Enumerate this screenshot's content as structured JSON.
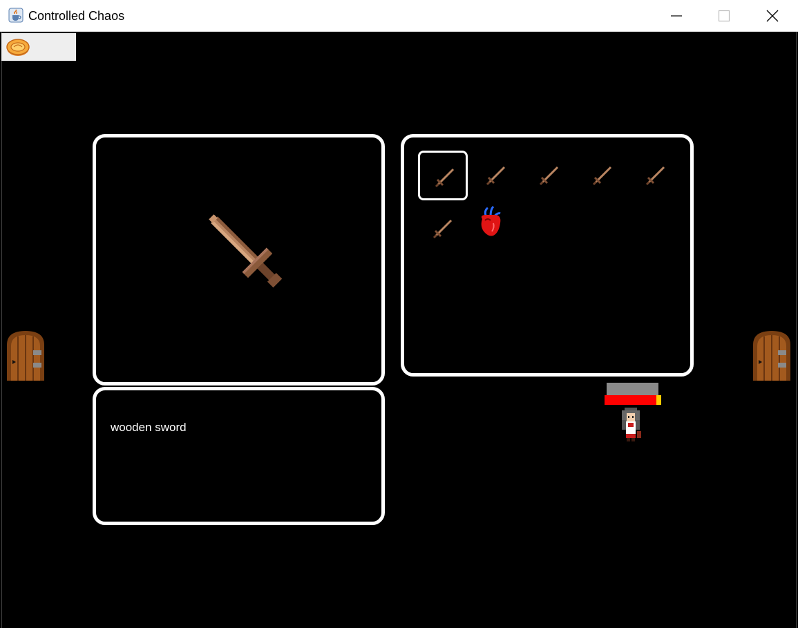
{
  "window": {
    "title": "Controlled Chaos",
    "app_icon": "java-cup-icon",
    "controls": [
      "minimize-icon",
      "maximize-icon",
      "close-icon"
    ]
  },
  "hud": {
    "menu_icon": "gold-coin-icon",
    "health_fraction": 0.92
  },
  "item_preview": {
    "icon": "wooden-sword-icon",
    "description": "wooden sword"
  },
  "inventory": {
    "selected_index": 0,
    "items": [
      {
        "icon": "wooden-sword-icon"
      },
      {
        "icon": "wooden-sword-icon"
      },
      {
        "icon": "wooden-sword-icon"
      },
      {
        "icon": "wooden-sword-icon"
      },
      {
        "icon": "wooden-sword-icon"
      },
      {
        "icon": "wooden-sword-icon"
      },
      {
        "icon": "heart-organ-icon"
      }
    ]
  },
  "scene": {
    "doors": [
      "left-door-icon",
      "right-door-icon"
    ],
    "player": "player-character-icon"
  },
  "colors": {
    "background": "#000000",
    "panel_border": "#ffffff",
    "health": "#ff0000",
    "health_cap": "#ffcc00",
    "sword": "#a0694b"
  }
}
